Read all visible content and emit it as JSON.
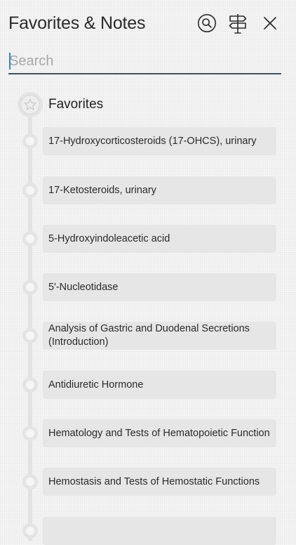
{
  "header": {
    "title": "Favorites & Notes"
  },
  "search": {
    "placeholder": "Search",
    "value": ""
  },
  "section": {
    "title": "Favorites"
  },
  "items": [
    {
      "label": "17-Hydroxycorticosteroids (17-OHCS), urinary"
    },
    {
      "label": "17-Ketosteroids, urinary"
    },
    {
      "label": "5-Hydroxyindoleacetic acid"
    },
    {
      "label": "5'-Nucleotidase"
    },
    {
      "label": "Analysis of Gastric and Duodenal Secretions (Introduction)"
    },
    {
      "label": "Antidiuretic Hormone"
    },
    {
      "label": "Hematology and Tests of Hematopoietic Function"
    },
    {
      "label": "Hemostasis and Tests of Hemostatic Functions"
    },
    {
      "label": ""
    }
  ],
  "colors": {
    "underline": "#40515a",
    "card": "#e6e6e6",
    "timeline": "#e2e2e2",
    "caret": "#3f82c8"
  }
}
